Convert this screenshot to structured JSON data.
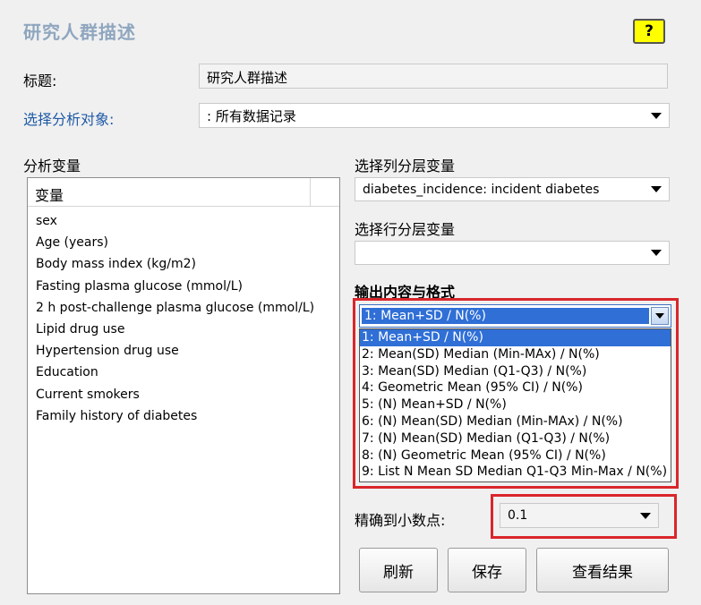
{
  "header": {
    "title": "研究人群描述",
    "help_label": "?"
  },
  "form": {
    "title_label": "标题:",
    "title_value": "研究人群描述",
    "object_label": "选择分析对象:",
    "object_value": ": 所有数据记录"
  },
  "variables": {
    "section_label": "分析变量",
    "column_header": "变量",
    "items": [
      "sex",
      "Age (years)",
      "Body mass index (kg/m2)",
      "Fasting plasma glucose (mmol/L)",
      "2 h post-challenge plasma glucose (mmol/L)",
      "Lipid drug use",
      "Hypertension drug use",
      "Education",
      "Current smokers",
      "Family history of diabetes"
    ]
  },
  "column_strat": {
    "label": "选择列分层变量",
    "value": "diabetes_incidence: incident diabetes"
  },
  "row_strat": {
    "label": "选择行分层变量",
    "value": ""
  },
  "output_format": {
    "label": "输出内容与格式",
    "selected": "1: Mean+SD / N(%)",
    "options": [
      "1: Mean+SD / N(%)",
      "2: Mean(SD) Median (Min-MAx) / N(%)",
      "3: Mean(SD) Median (Q1-Q3) / N(%)",
      "4: Geometric Mean (95% CI) / N(%)",
      "5: (N) Mean+SD / N(%)",
      "6: (N) Mean(SD) Median (Min-MAx) / N(%)",
      "7: (N) Mean(SD) Median (Q1-Q3) / N(%)",
      "8: (N) Geometric Mean (95% CI) / N(%)",
      "9: List N Mean SD Median Q1-Q3 Min-Max / N(%)"
    ]
  },
  "precision": {
    "label": "精确到小数点:",
    "value": "0.1"
  },
  "buttons": {
    "refresh": "刷新",
    "save": "保存",
    "view": "查看结果"
  },
  "colors": {
    "highlight_border": "#d9262b",
    "selection": "#2f6fd6",
    "title": "#8fa6bf",
    "help_bg": "#ffff00"
  }
}
